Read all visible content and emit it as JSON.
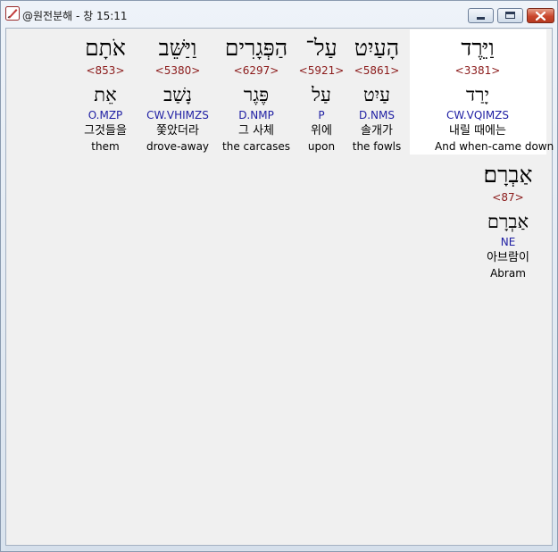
{
  "window": {
    "title": "@원전분해 - 창 15:11",
    "app_icon": "feather-quill-icon",
    "controls": {
      "minimize": "minimize-icon",
      "maximize": "maximize-icon",
      "close": "close-icon"
    }
  },
  "words": [
    {
      "hebrew": "וַיֵּרֶד",
      "strong": "<3381>",
      "lemma": "יָרַד",
      "morph": "CW.VQIMZS",
      "korean": "내릴 때에는",
      "english": "And when-came down",
      "selected": true
    },
    {
      "hebrew": "הָעַיִט",
      "strong": "<5861>",
      "lemma": "עַיִט",
      "morph": "D.NMS",
      "korean": "솔개가",
      "english": "the fowls"
    },
    {
      "hebrew": "עַל־",
      "strong": "<5921>",
      "lemma": "עַל",
      "morph": "P",
      "korean": "위에",
      "english": "upon"
    },
    {
      "hebrew": "הַפְּגָרִים",
      "strong": "<6297>",
      "lemma": "פֶּגֶר",
      "morph": "D.NMP",
      "korean": "그 사체",
      "english": "the carcases"
    },
    {
      "hebrew": "וַיַּשֵּׁב",
      "strong": "<5380>",
      "lemma": "נָשַׁב",
      "morph": "CW.VHIMZS",
      "korean": "쫓았더라",
      "english": "drove-away"
    },
    {
      "hebrew": "אֹתָם",
      "strong": "<853>",
      "lemma": "אֵת",
      "morph": "O.MZP",
      "korean": "그것들을",
      "english": "them"
    },
    {
      "hebrew": "אַבְרָם׃",
      "strong": "<87>",
      "lemma": "אַבְרָם",
      "morph": "NE",
      "korean": "아브람이",
      "english": "Abram"
    }
  ],
  "colors": {
    "strong": "#8b1a1a",
    "morph": "#1f1fa3",
    "selected_background": "#ffffff",
    "client_background": "#f0f0f0"
  }
}
